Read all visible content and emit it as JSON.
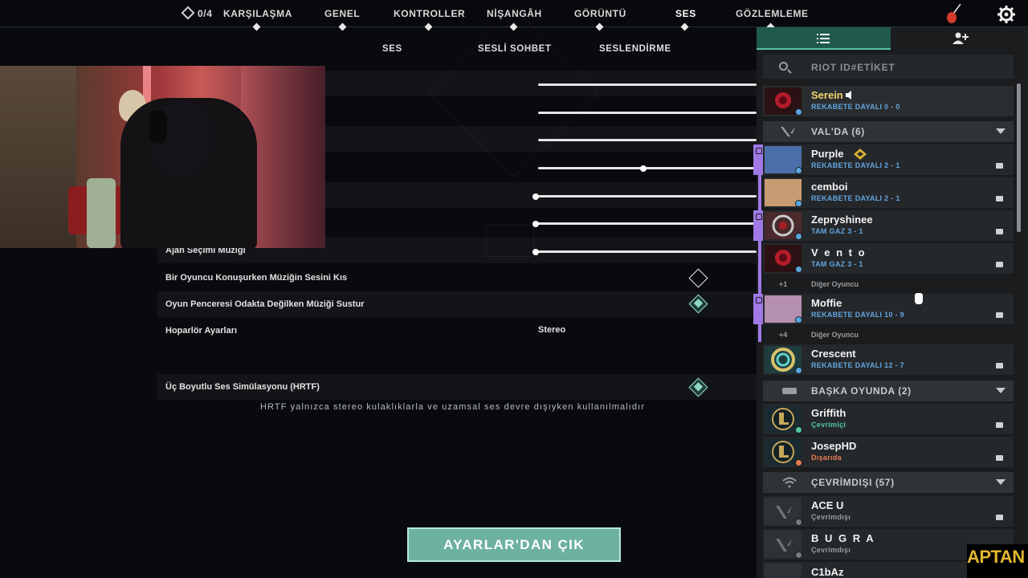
{
  "topnav": {
    "match_count": "0/4",
    "items": [
      "KARŞILAŞMA",
      "GENEL",
      "KONTROLLER",
      "NİŞANGÂH",
      "GÖRÜNTÜ",
      "SES",
      "GÖZLEMLEME"
    ],
    "active": "SES"
  },
  "subnav": {
    "items": [
      "SES",
      "SESLİ SOHBET",
      "SESLENDİRME"
    ]
  },
  "settings": {
    "agent_select_music": "Ajan Seçimi Müziği",
    "mute_music_when_talking": "Bir Oyuncu Konuşurken Müziğin Sesini Kıs",
    "mute_music_unfocused": "Oyun Penceresi Odakta Değilken Müziği Sustur",
    "speaker_settings": "Hoparlör Ayarları",
    "speaker_value": "Stereo",
    "hrtf": "Üç Boyutlu Ses Simülasyonu (HRTF)",
    "hrtf_note": "HRTF yalnızca stereo kulaklıklarla ve uzamsal ses devre dışıyken kullanılmalıdır",
    "slider_levels": [
      1.0,
      1.0,
      1.0,
      0.5,
      0.0,
      0.0,
      0.0
    ],
    "mute_music_when_talking_checked": false,
    "mute_music_unfocused_checked": true,
    "hrtf_checked": true
  },
  "exit_button": "AYARLAR'DAN ÇIK",
  "social": {
    "search_placeholder": "RIOT ID#ETİKET",
    "self": {
      "name": "Serein",
      "status": "REKABETE DAYALI 0 - 0"
    },
    "groups": {
      "valorant": "VAL'DA (6)",
      "other_game": "BAŞKA OYUNDA (2)",
      "offline": "ÇEVRİMDIŞI (57)"
    },
    "friends": [
      {
        "name": "Purple",
        "status": "REKABETE DAYALI  2 - 1"
      },
      {
        "name": "cemboi",
        "status": "REKABETE DAYALI  2 - 1"
      },
      {
        "name": "Zepryshinee",
        "status": "TAM GAZ  3 - 1"
      },
      {
        "name": "V e n t o",
        "status": "TAM GAZ  3 - 1"
      },
      {
        "name": "Moffie",
        "status": "REKABETE DAYALI  10 - 9"
      },
      {
        "name": "Crescent",
        "status": "REKABETE DAYALI  12 - 7"
      },
      {
        "name": "Griffith",
        "status": "Çevrimiçi"
      },
      {
        "name": "JosepHD",
        "status": "Dışarıda"
      },
      {
        "name": "ACE U",
        "status": "Çevrimdışı"
      },
      {
        "name": "B U G R A",
        "status": "Çevrimdışı"
      },
      {
        "name": "C1bAz",
        "status": ""
      }
    ],
    "more_1": {
      "count": "+1",
      "label": "Diğer Oyuncu"
    },
    "more_2": {
      "count": "+4",
      "label": "Diğer Oyuncu"
    }
  },
  "watermark": "APTAN",
  "colors": {
    "accent": "#6db29f",
    "party": "#a079e6",
    "panel": "#1a1c1e"
  }
}
